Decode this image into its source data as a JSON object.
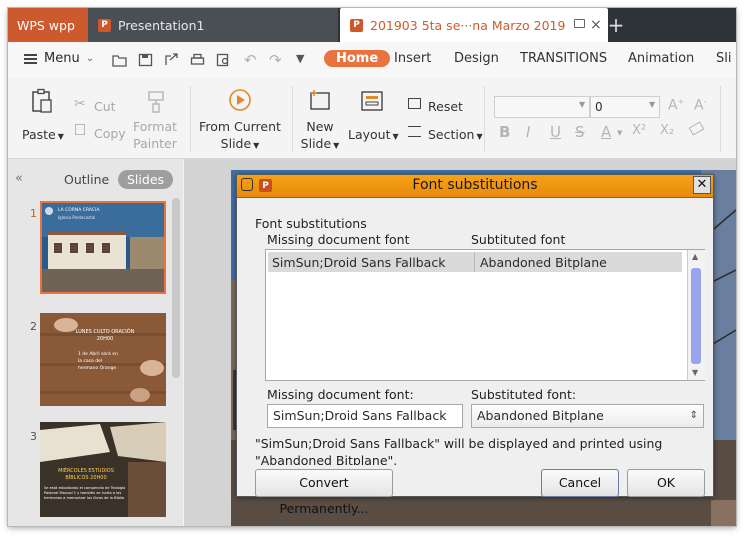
{
  "tabs": {
    "app": "WPS wpp",
    "presentation1": "Presentation1",
    "presentation2": "201903 5ta se···na Marzo 2019",
    "new_tab": "+"
  },
  "menubar": {
    "menu": "Menu",
    "tabs": [
      "Home",
      "Insert",
      "Design",
      "TRANSITIONS",
      "Animation",
      "Sli"
    ]
  },
  "ribbon": {
    "paste": "Paste",
    "cut": "Cut",
    "copy": "Copy",
    "format_painter_1": "Format",
    "format_painter_2": "Painter",
    "from_current_1": "From Current",
    "from_current_2": "Slide",
    "new_slide_1": "New",
    "new_slide_2": "Slide",
    "layout": "Layout",
    "reset": "Reset",
    "section": "Section",
    "font_name": "",
    "font_size": "0",
    "format_buttons": [
      "B",
      "I",
      "U",
      "S",
      "A",
      "X²",
      "X₂"
    ]
  },
  "pane": {
    "outline": "Outline",
    "slides": "Slides",
    "thumbnails": [
      {
        "num": "1",
        "title": "LA CORNA CRACIA",
        "subtitle": "Iglesia Pentecostal"
      },
      {
        "num": "2",
        "title": "LUNES CULTO ORACIÓN 20H00",
        "subtitle": "1 de Abril será en la casa del hermano Orange"
      },
      {
        "num": "3",
        "title": "MIÉRCOLES ESTUDIOS BÍBLICOS 20H00",
        "subtitle": "Se está estudiando el compendio de Teología Pastoral Manual 1 y también se invita a los hermanos a memorizar los libros de la Biblia"
      }
    ]
  },
  "dialog": {
    "title": "Font substitutions",
    "group_label": "Font substitutions",
    "col_missing": "Missing document font",
    "col_substituted": "Subtituted font",
    "row_missing": "SimSun;Droid Sans Fallback",
    "row_substituted": "Abandoned Bitplane",
    "missing_label": "Missing document font:",
    "substituted_label": "Substituted font:",
    "missing_value": "SimSun;Droid Sans Fallback",
    "substituted_value": "Abandoned Bitplane",
    "message": "\"SimSun;Droid Sans Fallback\" will be displayed and printed using \"Abandoned Bitplane\".",
    "convert_button": "Convert Permanently...",
    "cancel_button": "Cancel",
    "ok_button": "OK"
  },
  "colors": {
    "accent": "#e8733e",
    "titlebar": "#f29a14",
    "tabbar": "#2e3338"
  }
}
